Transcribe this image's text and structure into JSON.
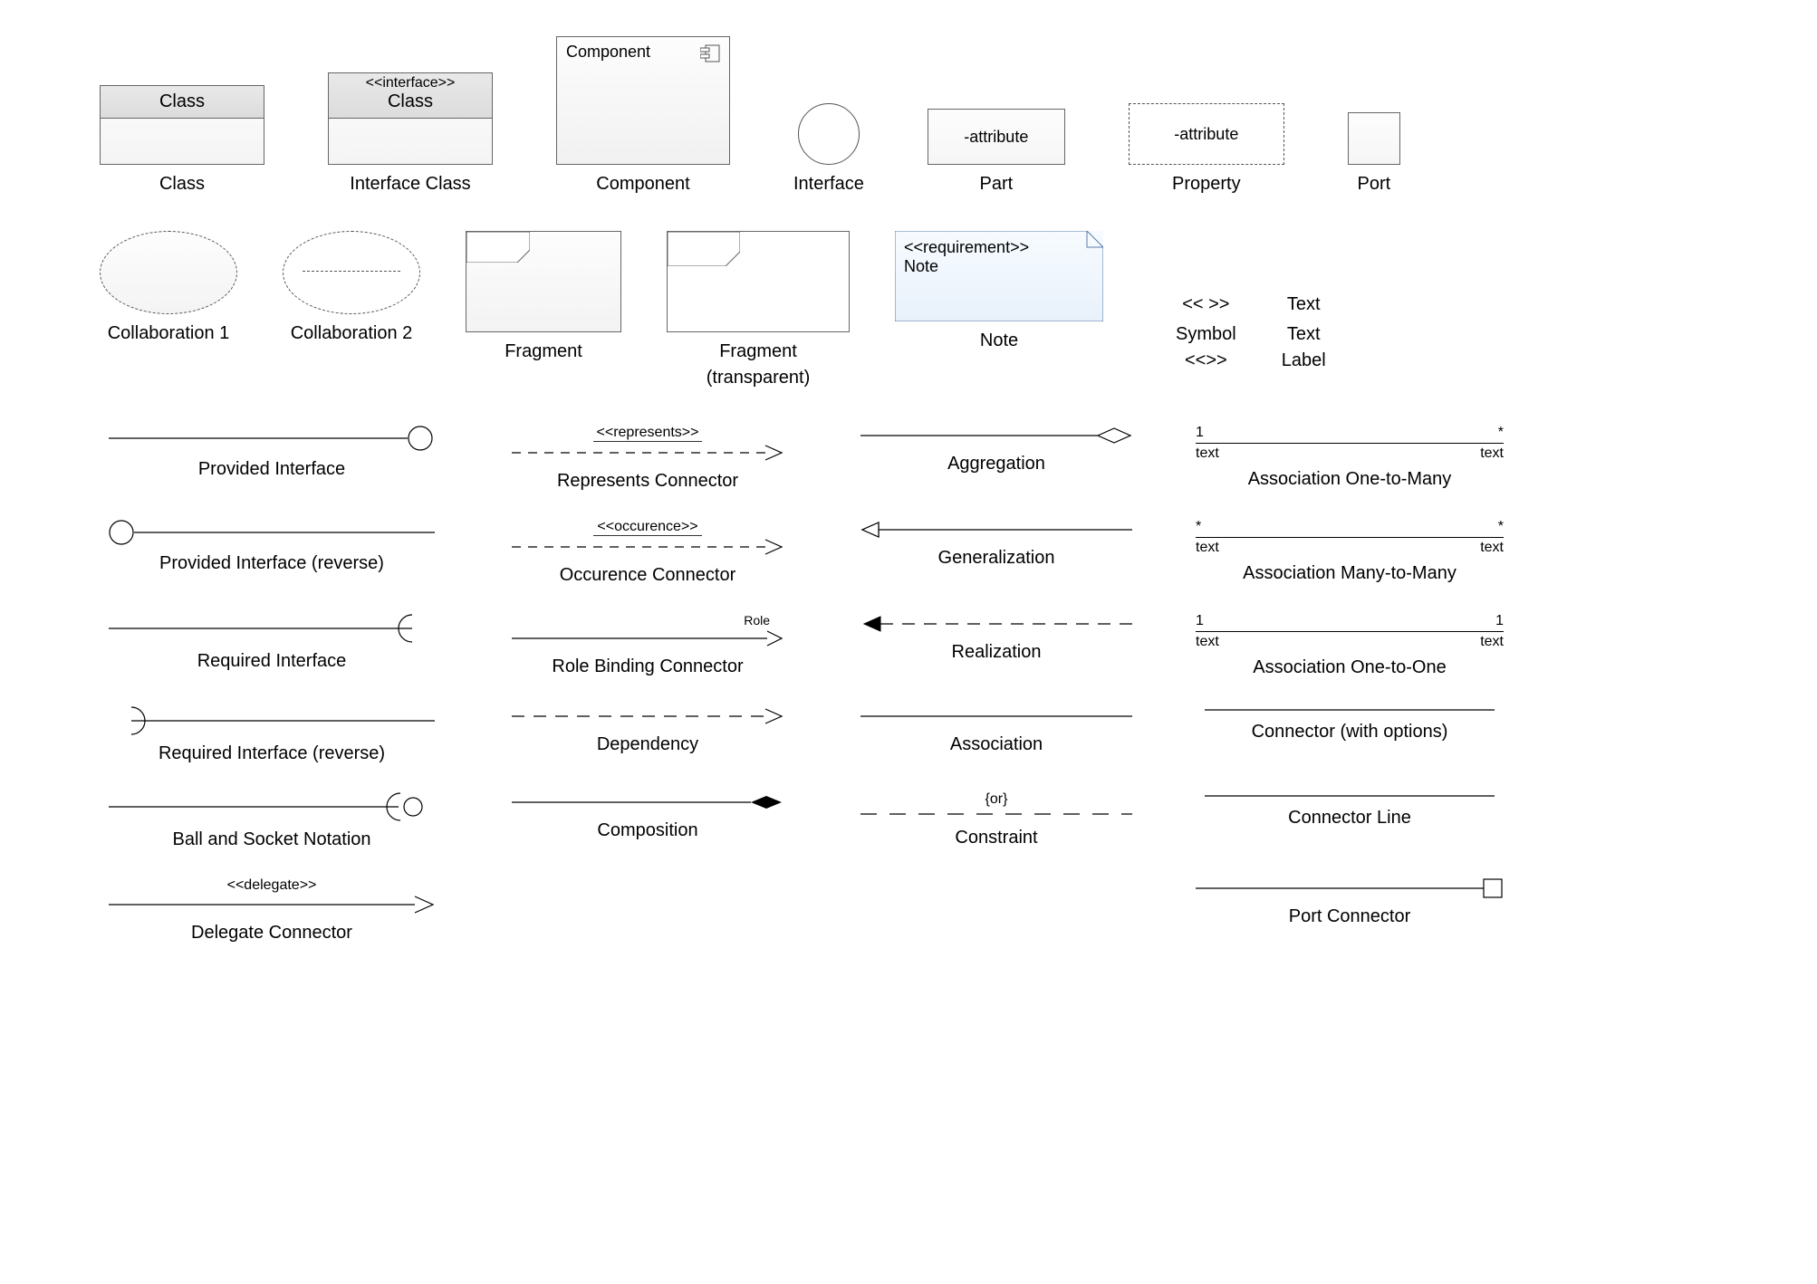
{
  "row1": {
    "class": {
      "title": "Class",
      "caption": "Class"
    },
    "interfaceClass": {
      "stereotype": "<<interface>>",
      "title": "Class",
      "caption": "Interface Class"
    },
    "component": {
      "title": "Component",
      "caption": "Component"
    },
    "interface": {
      "caption": "Interface"
    },
    "part": {
      "text": "-attribute",
      "caption": "Part"
    },
    "property": {
      "text": "-attribute",
      "caption": "Property"
    },
    "port": {
      "caption": "Port"
    }
  },
  "row2": {
    "collab1": {
      "caption": "Collaboration 1"
    },
    "collab2": {
      "caption": "Collaboration 2"
    },
    "fragment": {
      "caption": "Fragment"
    },
    "fragmentT": {
      "caption1": "Fragment",
      "caption2": "(transparent)"
    },
    "note": {
      "stereo": "<<requirement>>",
      "text": "Note",
      "caption": "Note"
    },
    "symbol": {
      "text": "<< >>",
      "caption1": "Symbol",
      "caption2": "<<>>"
    },
    "textLabel": {
      "text": "Text",
      "caption1": "Text",
      "caption2": "Label"
    }
  },
  "col1": {
    "provided": "Provided Interface",
    "providedRev": "Provided Interface (reverse)",
    "required": "Required Interface",
    "requiredRev": "Required Interface (reverse)",
    "ballSocket": "Ball and Socket Notation",
    "delegate": {
      "anno": "<<delegate>>",
      "caption": "Delegate Connector"
    }
  },
  "col2": {
    "represents": {
      "anno": "<<represents>>",
      "caption": "Represents Connector"
    },
    "occurence": {
      "anno": "<<occurence>>",
      "caption": "Occurence Connector"
    },
    "role": {
      "anno": "Role",
      "caption": "Role Binding Connector"
    },
    "dependency": "Dependency",
    "composition": "Composition"
  },
  "col3": {
    "aggregation": "Aggregation",
    "generalization": "Generalization",
    "realization": "Realization",
    "association": "Association",
    "constraint": {
      "anno": "{or}",
      "caption": "Constraint"
    }
  },
  "col4": {
    "oneToMany": {
      "l1": "1",
      "r1": "*",
      "l2": "text",
      "r2": "text",
      "caption": "Association One-to-Many"
    },
    "manyToMany": {
      "l1": "*",
      "r1": "*",
      "l2": "text",
      "r2": "text",
      "caption": "Association Many-to-Many"
    },
    "oneToOne": {
      "l1": "1",
      "r1": "1",
      "l2": "text",
      "r2": "text",
      "caption": "Association One-to-One"
    },
    "connOptions": "Connector (with options)",
    "connLine": "Connector Line",
    "portConn": "Port Connector"
  }
}
